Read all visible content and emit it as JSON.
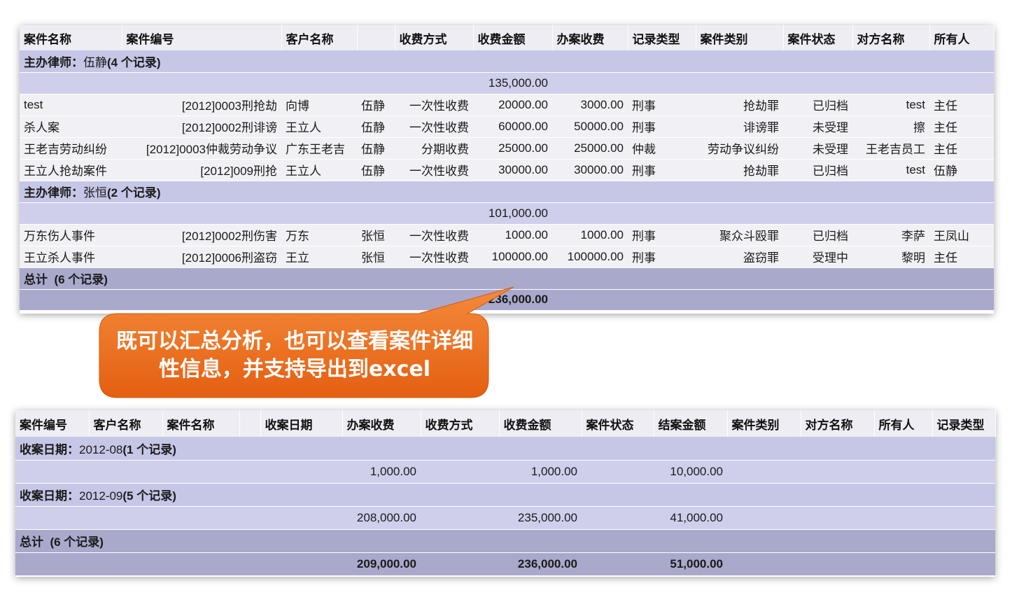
{
  "top_report": {
    "headers": [
      "案件名称",
      "案件编号",
      "客户名称",
      "",
      "收费方式",
      "收费金额",
      "办案收费",
      "记录类型",
      "案件类别",
      "案件状态",
      "对方名称",
      "所有人"
    ],
    "groups": [
      {
        "label": "主办律师：",
        "value": "伍静",
        "count": "(4 个记录)",
        "subtotal": "135,000.00",
        "rows": [
          [
            "test",
            "[2012]0003刑抢劫",
            "向博",
            "伍静",
            "一次性收费",
            "20000.00",
            "3000.00",
            "刑事",
            "抢劫罪",
            "已归档",
            "test",
            "主任"
          ],
          [
            "杀人案",
            "[2012]0002刑诽谤",
            "王立人",
            "伍静",
            "一次性收费",
            "60000.00",
            "50000.00",
            "刑事",
            "诽谤罪",
            "未受理",
            "擦",
            "主任"
          ],
          [
            "王老吉劳动纠纷",
            "[2012]0003仲裁劳动争议",
            "广东王老吉",
            "伍静",
            "分期收费",
            "25000.00",
            "25000.00",
            "仲裁",
            "劳动争议纠纷",
            "未受理",
            "王老吉员工",
            "主任"
          ],
          [
            "王立人抢劫案件",
            "[2012]009刑抢",
            "王立人",
            "伍静",
            "一次性收费",
            "30000.00",
            "30000.00",
            "刑事",
            "抢劫罪",
            "已归档",
            "test",
            "伍静"
          ]
        ]
      },
      {
        "label": "主办律师：",
        "value": "张恒",
        "count": "(2 个记录)",
        "subtotal": "101,000.00",
        "rows": [
          [
            "万东伤人事件",
            "[2012]0002刑伤害",
            "万东",
            "张恒",
            "一次性收费",
            "1000.00",
            "1000.00",
            "刑事",
            "聚众斗殴罪",
            "已归档",
            "李萨",
            "王凤山"
          ],
          [
            "王立杀人事件",
            "[2012]0006刑盗窃",
            "王立",
            "张恒",
            "一次性收费",
            "100000.00",
            "100000.00",
            "刑事",
            "盗窃罪",
            "受理中",
            "黎明",
            "主任"
          ]
        ]
      }
    ],
    "total_label": "总计",
    "total_count": "(6 个记录)",
    "total_amount": "236,000.00"
  },
  "bottom_report": {
    "headers": [
      "案件编号",
      "客户名称",
      "案件名称",
      "",
      "收案日期",
      "办案收费",
      "收费方式",
      "收费金额",
      "案件状态",
      "结案金额",
      "案件类别",
      "对方名称",
      "所有人",
      "记录类型"
    ],
    "groups": [
      {
        "label": "收案日期：",
        "value": "2012-08",
        "count": "(1 个记录)",
        "handling_fee": "1,000.00",
        "charge_amount": "1,000.00",
        "closing_amount": "10,000.00"
      },
      {
        "label": "收案日期：",
        "value": "2012-09",
        "count": "(5 个记录)",
        "handling_fee": "208,000.00",
        "charge_amount": "235,000.00",
        "closing_amount": "41,000.00"
      }
    ],
    "total_label": "总计",
    "total_count": "(6 个记录)",
    "total_handling_fee": "209,000.00",
    "total_charge_amount": "236,000.00",
    "total_closing_amount": "51,000.00"
  },
  "callout": {
    "text": "既可以汇总分析，也可以查看案件详细性信息，并支持导出到excel",
    "color": "#ee6d1c"
  }
}
